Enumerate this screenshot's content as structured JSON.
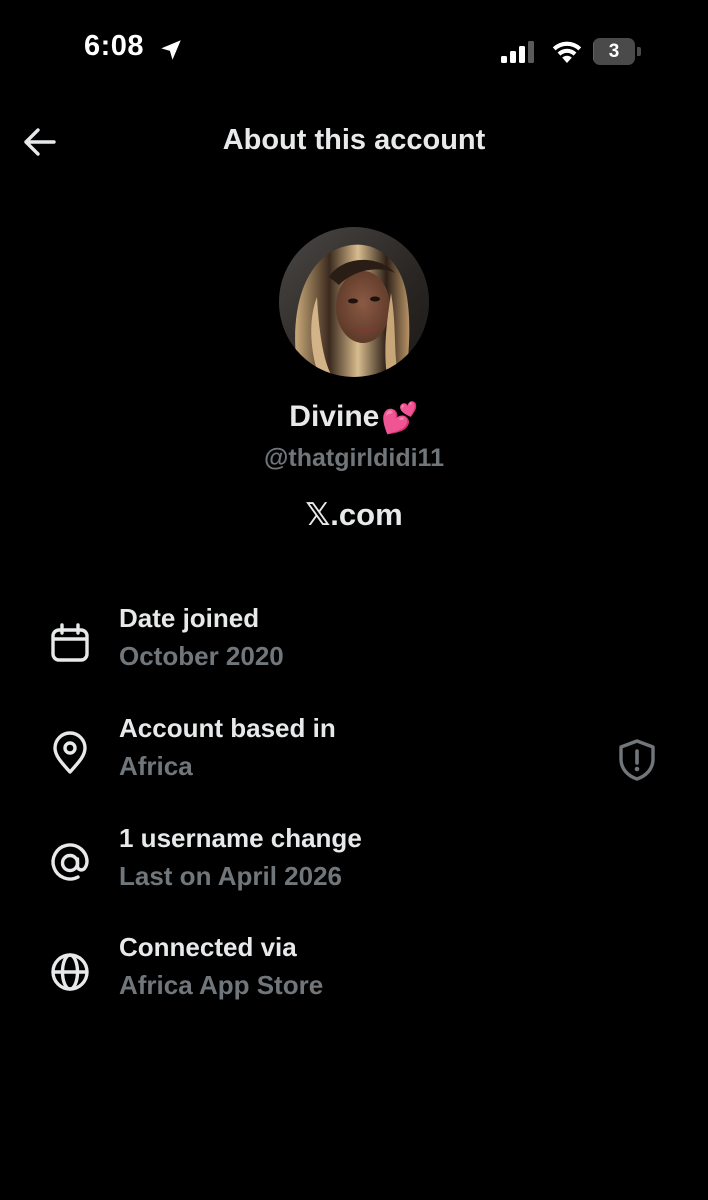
{
  "status_bar": {
    "time": "6:08",
    "battery_level": "3",
    "battery_percent": 3
  },
  "header": {
    "title": "About this account",
    "back_icon": "arrow-left-icon"
  },
  "profile": {
    "display_name": "Divine",
    "name_emoji": "💕",
    "username": "@thatgirldidi11",
    "platform": "𝕏.com"
  },
  "details": [
    {
      "icon": "calendar-icon",
      "label": "Date joined",
      "value": "October 2020"
    },
    {
      "icon": "location-pin-icon",
      "label": "Account based in",
      "value": "Africa",
      "action_icon": "shield-alert-icon"
    },
    {
      "icon": "at-sign-icon",
      "label": "1 username change",
      "value": "Last on April 2026"
    },
    {
      "icon": "globe-icon",
      "label": "Connected via",
      "value": "Africa App Store"
    }
  ],
  "colors": {
    "background": "#000000",
    "primary_text": "#e7e9ea",
    "secondary_text": "#71767b",
    "battery_low": "#d9311c"
  }
}
